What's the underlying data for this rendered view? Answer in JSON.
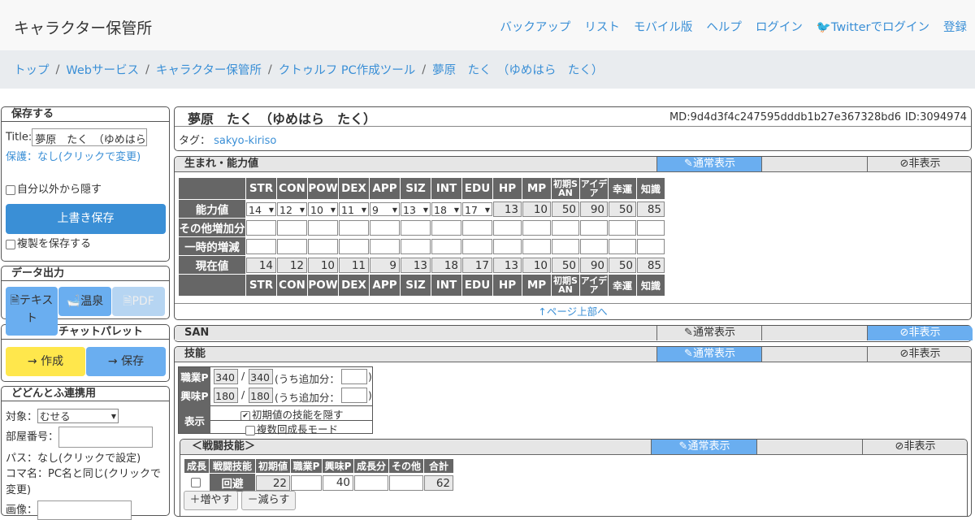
{
  "nav": {
    "brand": "キャラクター保管所",
    "links": [
      "バックアップ",
      "リスト",
      "モバイル版",
      "ヘルプ",
      "ログイン",
      "Twitterでログイン",
      "登録"
    ]
  },
  "breadcrumb": [
    "トップ",
    "Webサービス",
    "キャラクター保管所",
    "クトゥルフ PC作成ツール",
    "夢原　たく　（ゆめはら　たく）"
  ],
  "save_panel": {
    "header": "保存する",
    "title_label": "Title:",
    "title_value": "夢原　たく　（ゆめはら",
    "protect_link": "保護：なし(クリックで変更)",
    "hide_label": "自分以外から隠す",
    "save_button": "上書き保存",
    "copy_label": "複製を保存する"
  },
  "export_panel": {
    "header": "データ出力",
    "text_btn": "テキスト",
    "onsen_btn": "温泉",
    "pdf_btn": "PDF"
  },
  "palette_panel": {
    "header": "チャットパレット",
    "create_btn": "→ 作成",
    "save_btn": "→ 保存"
  },
  "dodontof_panel": {
    "header": "どどんとふ連携用",
    "target_label": "対象：",
    "target_value": "むせる",
    "room_label": "部屋番号：",
    "pass_text": "パス：なし(クリックで設定)",
    "koma_text": "コマ名：PC名と同じ(クリックで変更)",
    "image_label": "画像："
  },
  "character": {
    "name": "夢原　たく　（ゆめはら　たく）",
    "md": "MD:9d4d3f4c247595dddb1b27e367328bd6",
    "id": "ID:3094974",
    "tag_label": "タグ：",
    "tag": "sakyo-kiriso"
  },
  "sections": {
    "normal": "通常表示",
    "hide": "非表示",
    "ability_title": "生まれ・能力値",
    "san_title": "SAN",
    "skill_title": "技能",
    "page_top": "↑ページ上部へ"
  },
  "ability": {
    "headers": [
      "STR",
      "CON",
      "POW",
      "DEX",
      "APP",
      "SIZ",
      "INT",
      "EDU",
      "HP",
      "MP",
      "初期SAN",
      "アイデア",
      "幸運",
      "知識"
    ],
    "row_labels": [
      "能力値",
      "その他増加分",
      "一時的増減",
      "現在値"
    ],
    "base": [
      "14",
      "12",
      "10",
      "11",
      "9",
      "13",
      "18",
      "17",
      "13",
      "10",
      "50",
      "90",
      "50",
      "85"
    ],
    "current": [
      "14",
      "12",
      "10",
      "11",
      "9",
      "13",
      "18",
      "17",
      "13",
      "10",
      "50",
      "90",
      "50",
      "85"
    ]
  },
  "points": {
    "job_label": "職業P",
    "job_rem": "340",
    "job_total": "340",
    "hobby_label": "興味P",
    "hobby_rem": "180",
    "hobby_total": "180",
    "slash": "/",
    "extra_label": "(うち追加分：",
    "close_paren": ")",
    "display_label": "表示",
    "hide_initial": "初期値の技能を隠す",
    "multi_growth": "複数回成長モード"
  },
  "combat": {
    "title": "＜戦闘技能＞",
    "headers": [
      "成長",
      "戦闘技能",
      "初期値",
      "職業P",
      "興味P",
      "成長分",
      "その他",
      "合計"
    ],
    "row": {
      "name": "回避",
      "initial": "22",
      "job": "",
      "hobby": "40",
      "growth": "",
      "other": "",
      "total": "62"
    },
    "add_btn": "＋増やす",
    "remove_btn": "－減らす"
  }
}
